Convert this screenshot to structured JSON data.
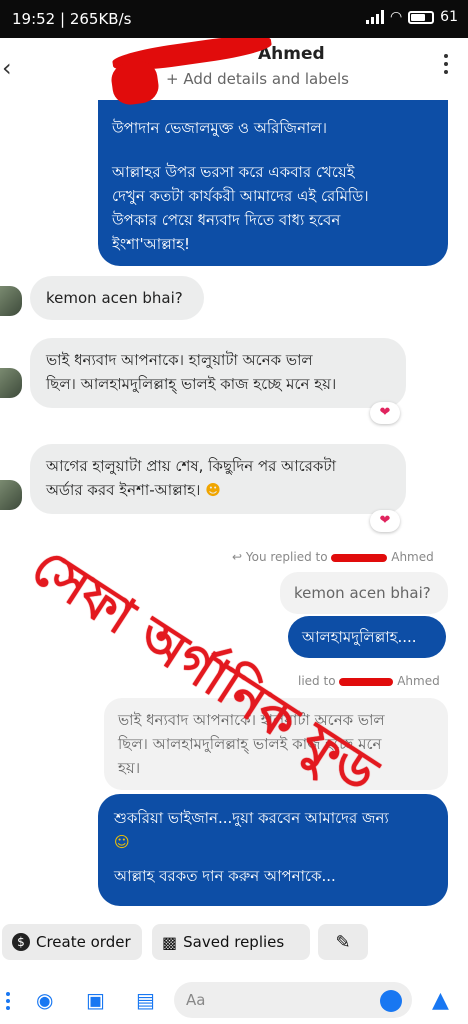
{
  "status_bar": {
    "time_speed": "19:52 | 265KB/s",
    "battery": "61"
  },
  "header": {
    "contact_name": "Ahmed",
    "subtitle": "+ Add details and labels"
  },
  "messages": {
    "first_outgoing": {
      "line1": "উপাদান ভেজালমুক্ত ও অরিজিনাল।",
      "line2": "আল্লাহর উপর ভরসা করে একবার খেয়েই",
      "line3": "দেখুন কতটা কার্যকরী আমাদের এই রেমিডি।",
      "line4": "উপকার পেয়ে ধন্যবাদ দিতে বাধ্য হবেন",
      "line5": "ইংশা'আল্লাহ!"
    },
    "incoming_1": "kemon acen bhai?",
    "incoming_2": {
      "line1": "ভাই ধন্যবাদ আপনাকে। হালুয়াটা অনেক ভাল",
      "line2": "ছিল। আলহামদুলিল্লাহ্ ভালই কাজ হচ্ছে মনে হয়।"
    },
    "incoming_3": {
      "line1": "আগের হালুয়াটা প্রায় শেষ, কিছুদিন পর আরেকটা",
      "line2": "অর্ডার করব ইনশা-আল্লাহ।"
    },
    "reply_1_label": "You replied to",
    "reply_1_name": "Ahmed",
    "reply_1_quote": "kemon acen bhai?",
    "reply_1_text": "আলহামদুলিল্লাহ....",
    "reply_2_label": "lied to",
    "reply_2_name": "Ahmed",
    "reply_2_quote": {
      "line1": "ভাই ধন্যবাদ আপনাকে। হালুয়াটা অনেক ভাল",
      "line2": "ছিল। আলহামদুলিল্লাহ্ ভালই কাজ হচ্ছে মনে",
      "line3": "হয়।"
    },
    "last_outgoing": {
      "line1": "শুকরিয়া ভাইজান...দুয়া করবেন আমাদের জন্য",
      "line2": "আল্লাহ বরকত দান করুন আপনাকে..."
    }
  },
  "watermark": "সেফা অর্গানিক ফুড",
  "quick_actions": {
    "create_order": "Create order",
    "saved_replies": "Saved replies"
  },
  "composer": {
    "placeholder": "Aa"
  },
  "colors": {
    "outgoing": "#0d4ea6",
    "incoming": "#eceded",
    "watermark": "#e3191f",
    "accent": "#1877f2"
  }
}
